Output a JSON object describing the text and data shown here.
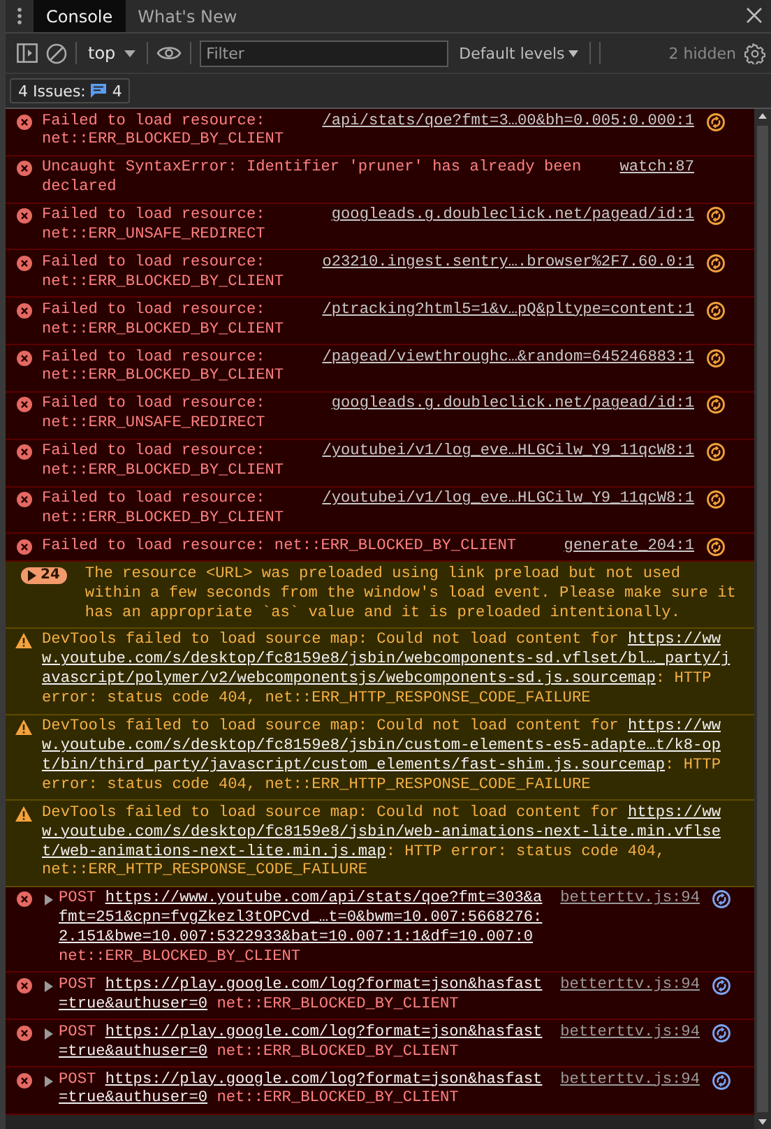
{
  "tabs": [
    {
      "label": "Console",
      "selected": true
    },
    {
      "label": "What's New",
      "selected": false
    }
  ],
  "toolbar": {
    "context": "top",
    "filter": {
      "placeholder": "Filter"
    },
    "levels": "Default levels",
    "hidden_count": "2 hidden"
  },
  "issues": {
    "label": "4 Issues:",
    "count": "4"
  },
  "messages": [
    {
      "kind": "error",
      "text": "Failed to load resource: net::ERR_BLOCKED_BY_CLIENT",
      "source": "/api/stats/qoe?fmt=3…00&bh=0.005:0.000:1",
      "badge": true
    },
    {
      "kind": "error",
      "text": "Uncaught SyntaxError: Identifier 'pruner' has already been declared",
      "source": "watch:87",
      "badge": false
    },
    {
      "kind": "error",
      "text": "Failed to load resource: net::ERR_UNSAFE_REDIRECT",
      "source": "googleads.g.doubleclick.net/pagead/id:1",
      "badge": true
    },
    {
      "kind": "error",
      "text": "Failed to load resource: net::ERR_BLOCKED_BY_CLIENT",
      "source": "o23210.ingest.sentry….browser%2F7.60.0:1",
      "badge": true
    },
    {
      "kind": "error",
      "text": "Failed to load resource: net::ERR_BLOCKED_BY_CLIENT",
      "source": "/ptracking?html5=1&v…pQ&pltype=content:1",
      "badge": true
    },
    {
      "kind": "error",
      "text": "Failed to load resource: net::ERR_BLOCKED_BY_CLIENT",
      "source": "/pagead/viewthroughc…&random=645246883:1",
      "badge": true
    },
    {
      "kind": "error",
      "text": "Failed to load resource: net::ERR_UNSAFE_REDIRECT",
      "source": "googleads.g.doubleclick.net/pagead/id:1",
      "badge": true
    },
    {
      "kind": "error",
      "text": "Failed to load resource: net::ERR_BLOCKED_BY_CLIENT",
      "source": "/youtubei/v1/log_eve…HLGCilw_Y9_11qcW8:1",
      "badge": true
    },
    {
      "kind": "error",
      "text": "Failed to load resource: net::ERR_BLOCKED_BY_CLIENT",
      "source": "/youtubei/v1/log_eve…HLGCilw_Y9_11qcW8:1",
      "badge": true
    },
    {
      "kind": "error",
      "text": "Failed to load resource: net::ERR_BLOCKED_BY_CLIENT",
      "source": "generate_204:1",
      "badge": true
    },
    {
      "kind": "group",
      "count": "24",
      "text": "The resource <URL> was preloaded using link preload but not used within a few seconds from the window's load event. Please make sure it has an appropriate `as` value and it is preloaded intentionally."
    },
    {
      "kind": "warning",
      "text": "DevTools failed to load source map: Could not load content for",
      "link": "https://www.youtube.com/s/desktop/fc8159e8/jsbin/webcomponents-sd.vflset/bl…_party/javascript/polymer/v2/webcomponentsjs/webcomponents-sd.js.sourcemap",
      "suffix": ": HTTP error: status code 404, net::ERR_HTTP_RESPONSE_CODE_FAILURE"
    },
    {
      "kind": "warning",
      "text": "DevTools failed to load source map: Could not load content for",
      "link": "https://www.youtube.com/s/desktop/fc8159e8/jsbin/custom-elements-es5-adapte…t/k8-opt/bin/third_party/javascript/custom_elements/fast-shim.js.sourcemap",
      "suffix": ": HTTP error: status code 404, net::ERR_HTTP_RESPONSE_CODE_FAILURE"
    },
    {
      "kind": "warning",
      "text": "DevTools failed to load source map: Could not load content for",
      "link": "https://www.youtube.com/s/desktop/fc8159e8/jsbin/web-animations-next-lite.min.vflset/web-animations-next-lite.min.js.map",
      "suffix": ": HTTP error: status code 404, net::ERR_HTTP_RESPONSE_CODE_FAILURE"
    },
    {
      "kind": "network",
      "method": "POST",
      "link": "https://www.youtube.com/api/stats/qoe?fmt=303&afmt=251&cpn=fvgZkezl3tOPCvd_…t=0&bwm=10.007:5668276:2.151&bwe=10.007:5322933&bat=10.007:1:1&df=10.007:0",
      "suffix": "net::ERR_BLOCKED_BY_CLIENT",
      "source": "betterttv.js:94"
    },
    {
      "kind": "network",
      "method": "POST",
      "link": "https://play.google.com/log?format=json&hasfast=true&authuser=0",
      "suffix": "net::ERR_BLOCKED_BY_CLIENT",
      "source": "betterttv.js:94"
    },
    {
      "kind": "network",
      "method": "POST",
      "link": "https://play.google.com/log?format=json&hasfast=true&authuser=0",
      "suffix": "net::ERR_BLOCKED_BY_CLIENT",
      "source": "betterttv.js:94"
    },
    {
      "kind": "network",
      "method": "POST",
      "link": "https://play.google.com/log?format=json&hasfast=true&authuser=0",
      "suffix": "net::ERR_BLOCKED_BY_CLIENT",
      "source": "betterttv.js:94"
    }
  ]
}
